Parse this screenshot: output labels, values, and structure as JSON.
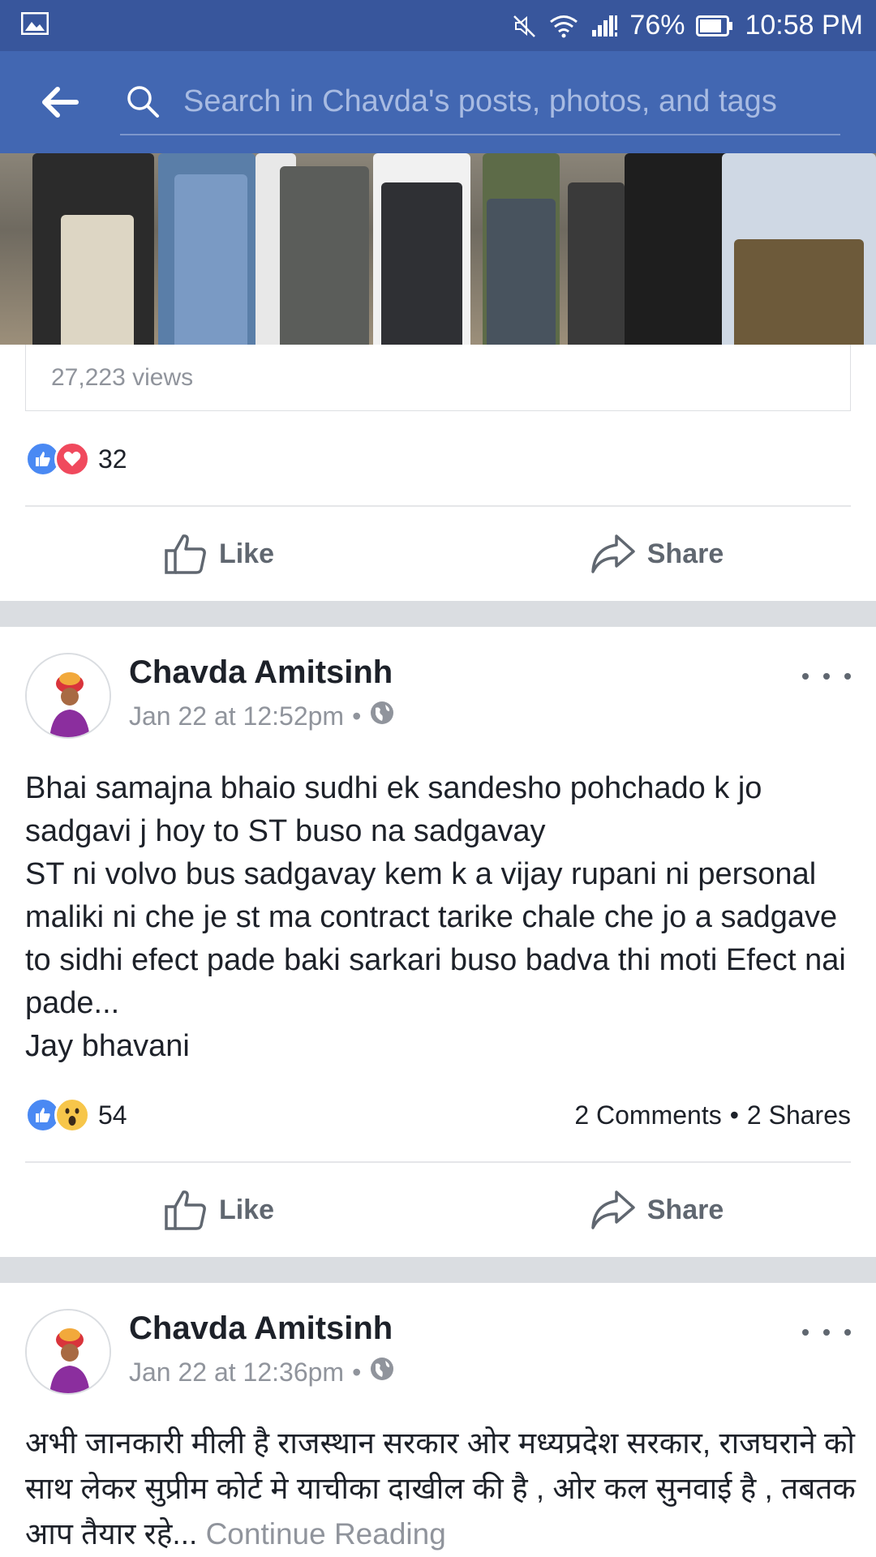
{
  "status_bar": {
    "battery": "76%",
    "time": "10:58 PM"
  },
  "header": {
    "search_placeholder": "Search in Chavda's posts, photos, and tags"
  },
  "first_post": {
    "views": "27,223 views",
    "reaction_count": "32",
    "like_label": "Like",
    "share_label": "Share"
  },
  "post2": {
    "author": "Chavda Amitsinh",
    "timestamp": "Jan 22 at 12:52pm",
    "body_lines": [
      "Bhai samajna bhaio sudhi ek sandesho pohchado k jo sadgavi j hoy to ST buso na sadgavay",
      "ST ni volvo bus sadgavay kem k a vijay rupani ni personal maliki ni che je st ma contract tarike chale che jo a sadgave to sidhi efect pade baki sarkari buso badva thi moti Efect nai pade...",
      "Jay bhavani"
    ],
    "reaction_count": "54",
    "comments": "2 Comments",
    "shares": "2 Shares",
    "like_label": "Like",
    "share_label": "Share"
  },
  "post3": {
    "author": "Chavda Amitsinh",
    "timestamp": "Jan 22 at 12:36pm",
    "body": "अभी जानकारी मीली है राजस्थान सरकार ओर मध्यप्रदेश सरकार, राजघराने को साथ लेकर सुप्रीम कोर्ट मे याचीका दाखील की है , ओर कल सुनवाई है , तबतक आप तैयार रहे...",
    "continue_label": "Continue Reading"
  },
  "colors": {
    "status_bar": "#38569c",
    "header": "#4267b2",
    "like_blue": "#4a89f3",
    "love_red": "#f0495d",
    "wow_yellow": "#f7c64a"
  }
}
